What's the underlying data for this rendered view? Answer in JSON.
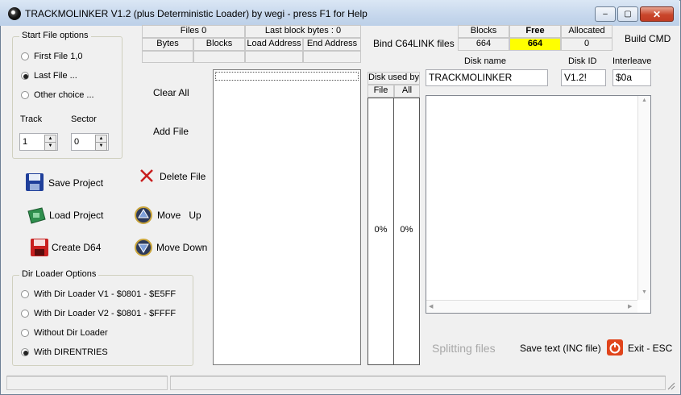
{
  "window": {
    "title": "TRACKMOLINKER V1.2 (plus Deterministic Loader) by wegi - press F1 for Help",
    "min_glyph": "–",
    "max_glyph": "▢",
    "close_glyph": "✕"
  },
  "start_options": {
    "title": "Start File options",
    "items": [
      {
        "label": "First File 1,0",
        "checked": false
      },
      {
        "label": "Last File ...",
        "checked": true
      },
      {
        "label": "Other choice ...",
        "checked": false
      }
    ],
    "track_label": "Track",
    "sector_label": "Sector",
    "track_value": "1",
    "sector_value": "0"
  },
  "file_info": {
    "files_label": "Files 0",
    "last_block_label": "Last block bytes : 0",
    "col_bytes": "Bytes",
    "col_blocks": "Blocks",
    "col_load": "Load Address",
    "col_end": "End Address"
  },
  "bind_label": "Bind C64LINK files",
  "blocks_table": {
    "h_blocks": "Blocks",
    "h_free": "Free",
    "h_allocated": "Allocated",
    "v_blocks": "664",
    "v_free": "664",
    "v_allocated": "0",
    "free_color": "#ffff00"
  },
  "build_cmd": "Build CMD",
  "actions": {
    "clear_all": "Clear All",
    "add_file": "Add File",
    "delete_file": "Delete File",
    "move_up": "Move   Up",
    "move_down": "Move Down",
    "save_project": "Save Project",
    "load_project": "Load Project",
    "create_d64": "Create D64"
  },
  "disk_usage": {
    "title": "Disk used by",
    "col_file": "File",
    "col_all": "All",
    "file_pct": "0%",
    "all_pct": "0%"
  },
  "disk": {
    "name_label": "Disk name",
    "id_label": "Disk ID",
    "interleave_label": "Interleave",
    "name_value": "TRACKMOLINKER",
    "id_value": "V1.2!",
    "interleave_value": "$0a"
  },
  "dir_loader": {
    "title": "Dir Loader Options",
    "items": [
      {
        "label": "With Dir Loader V1 - $0801 - $E5FF",
        "checked": false
      },
      {
        "label": "With Dir Loader V2 - $0801 - $FFFF",
        "checked": false
      },
      {
        "label": "Without Dir Loader",
        "checked": false
      },
      {
        "label": "With DIRENTRIES",
        "checked": true
      }
    ]
  },
  "bottom": {
    "splitting": "Splitting files",
    "save_text": "Save text (INC file)",
    "exit": "Exit - ESC"
  },
  "icons": {
    "save_project": "floppy-disk-blue-icon",
    "load_project": "green-chip-icon",
    "create_d64": "floppy-disk-red-icon",
    "delete_file": "red-x-icon",
    "move_up": "arrow-up-icon",
    "move_down": "arrow-down-icon",
    "exit": "power-icon"
  }
}
